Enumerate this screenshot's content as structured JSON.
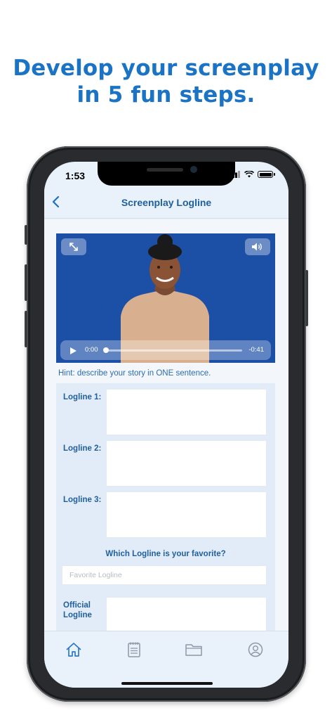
{
  "headline": {
    "line1": "Develop your screenplay",
    "line2": "in 5 fun steps."
  },
  "status_bar": {
    "time": "1:53"
  },
  "nav": {
    "title": "Screenplay Logline"
  },
  "video": {
    "current_time": "0:00",
    "remaining_time": "-0:41",
    "progress": 0,
    "background_color": "#1c4fa6"
  },
  "hint": "Hint: describe your story in ONE sentence.",
  "form": {
    "logline_1_label": "Logline 1:",
    "logline_2_label": "Logline 2:",
    "logline_3_label": "Logline 3:",
    "favorite_question": "Which Logline is your favorite?",
    "favorite_placeholder": "Favorite Logline",
    "official_label_line1": "Official",
    "official_label_line2": "Logline"
  },
  "tabbar": {
    "items": [
      {
        "icon": "home-icon",
        "selected": true
      },
      {
        "icon": "notepad-icon",
        "selected": false
      },
      {
        "icon": "folder-icon",
        "selected": false
      },
      {
        "icon": "profile-icon",
        "selected": false
      }
    ]
  },
  "colors": {
    "accent": "#1a73c4",
    "label_blue": "#1f5f9e"
  }
}
